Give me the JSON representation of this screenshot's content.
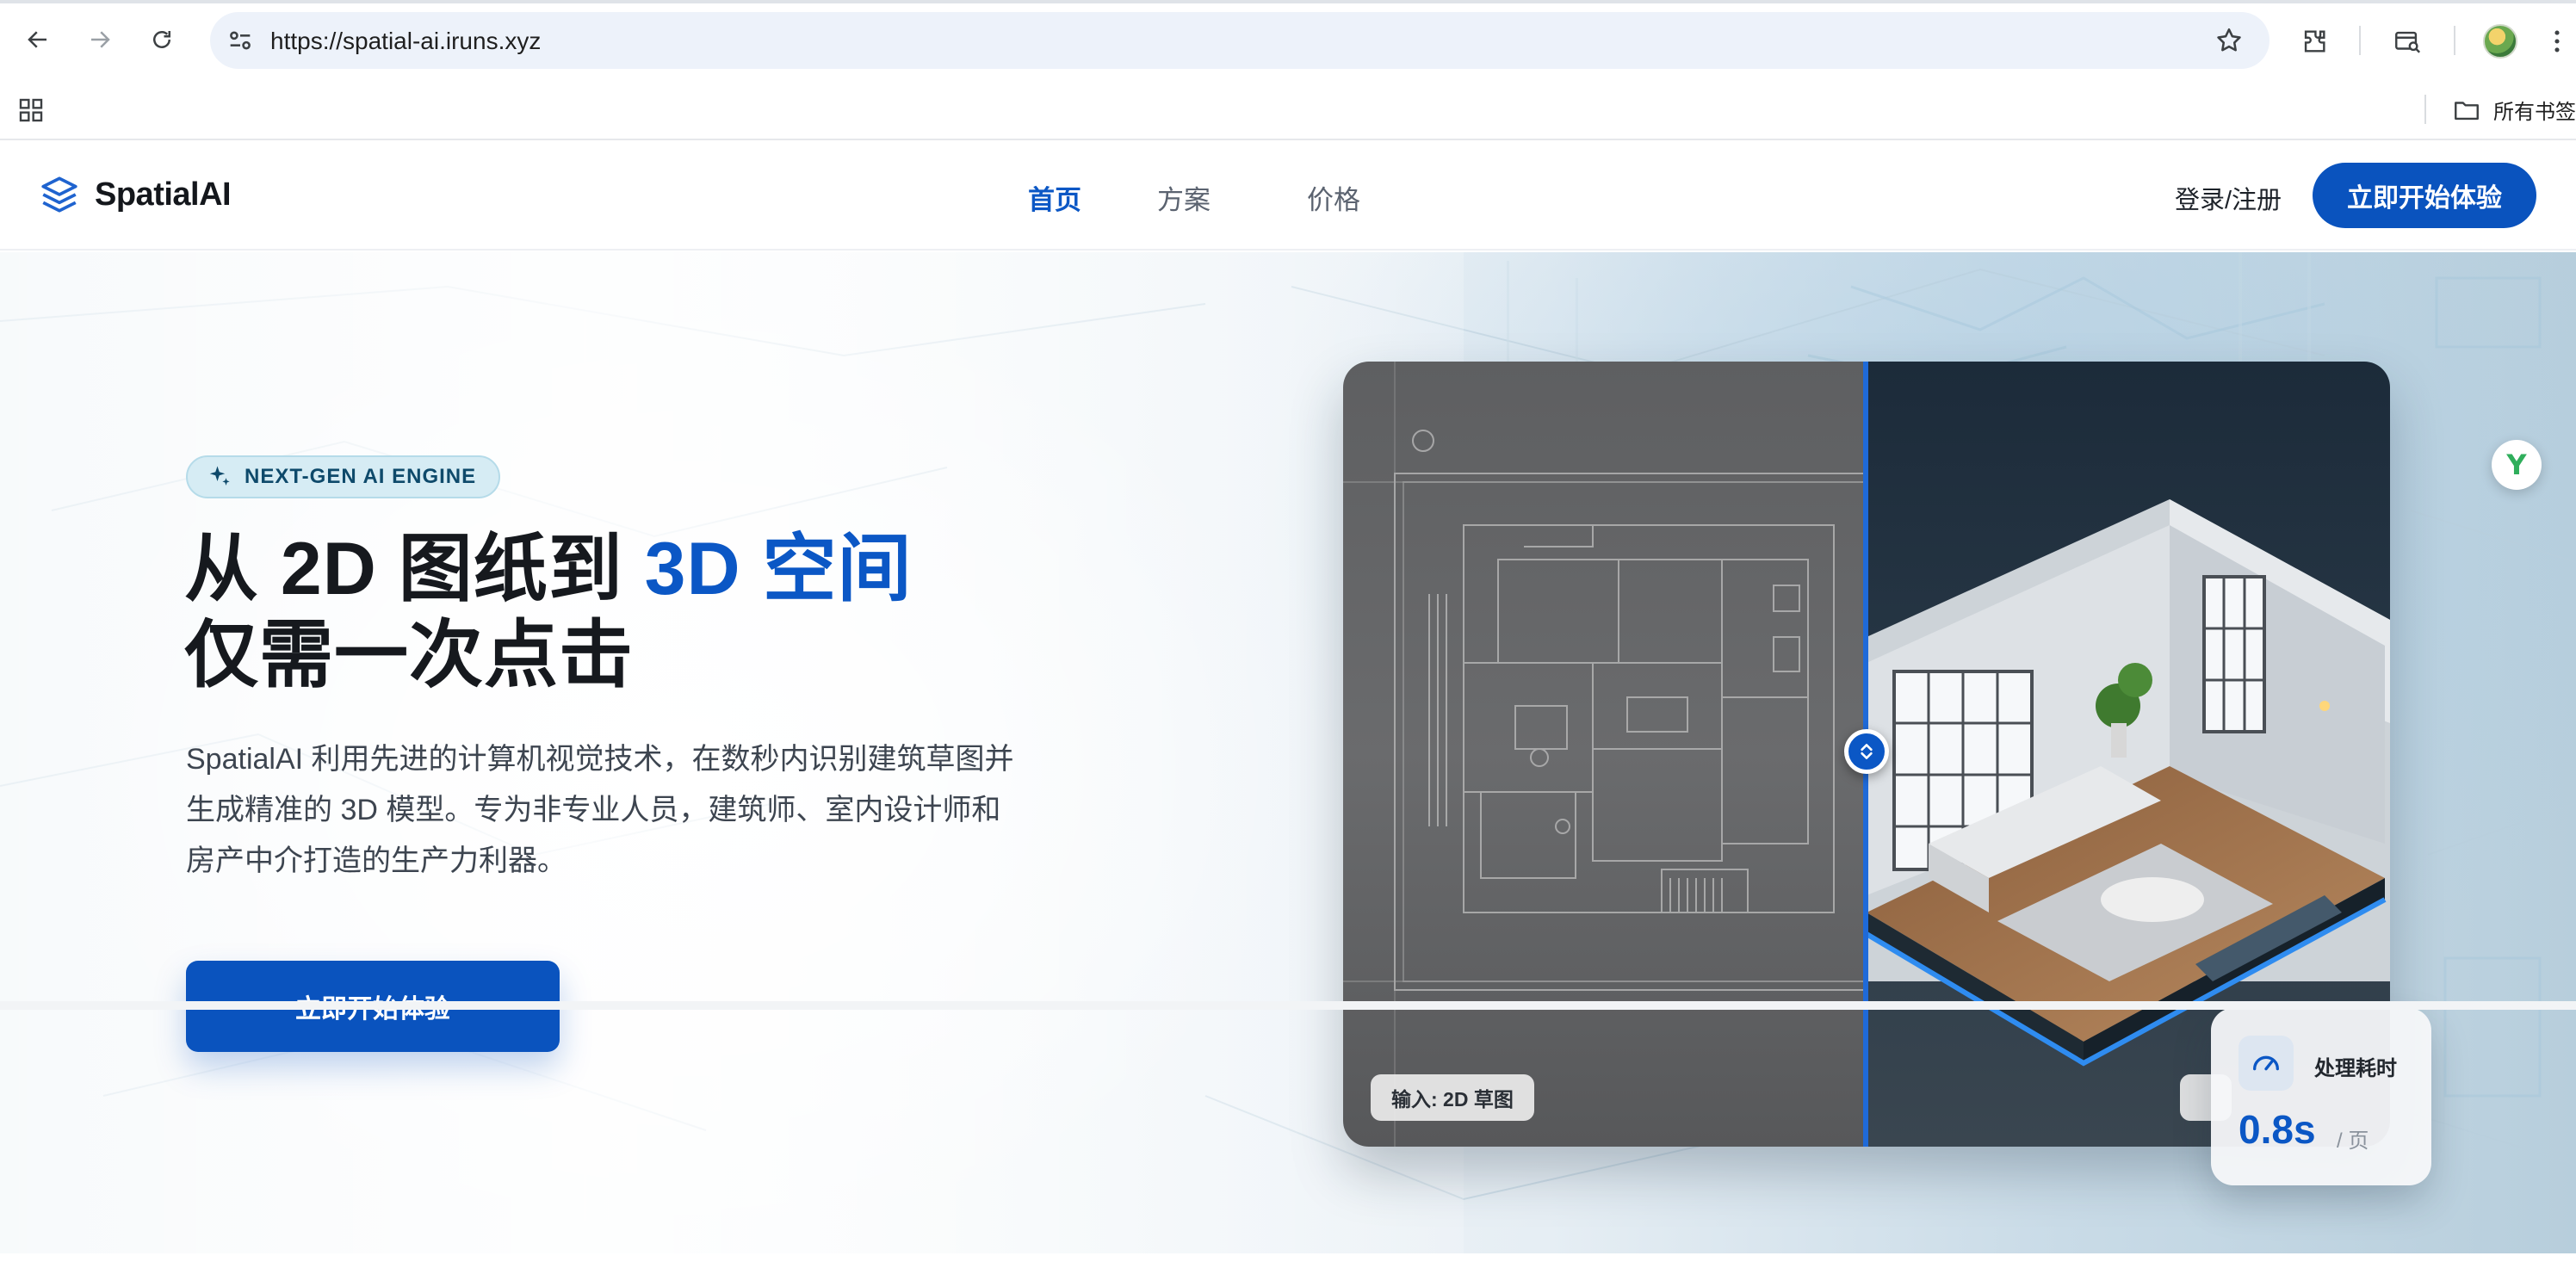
{
  "browser": {
    "url": "https://spatial-ai.iruns.xyz",
    "bookmarks_folder": "所有书签"
  },
  "site": {
    "logo_text": "SpatialAI",
    "nav": [
      {
        "label": "首页",
        "active": true
      },
      {
        "label": "方案",
        "active": false
      },
      {
        "label": "价格",
        "active": false
      }
    ],
    "login_label": "登录/注册",
    "cta_label": "立即开始体验"
  },
  "hero": {
    "badge": "NEXT-GEN AI ENGINE",
    "headline_part1": "从 2D 图纸到 ",
    "headline_accent": "3D 空间",
    "headline_line2": "仅需一次点击",
    "description_lines": [
      "SpatialAI 利用先进的计算机视觉技术，在数秒内识别建筑草图并",
      "生成精准的 3D 模型。专为非专业人员，建筑师、室内设计师和",
      "房产中介打造的生产力利器。"
    ],
    "cta_label": "立即开始体验"
  },
  "compare": {
    "input_tag": "输入: 2D 草图"
  },
  "stat": {
    "title": "处理耗时",
    "value": "0.8s",
    "unit": "/ 页"
  },
  "float_button_glyph": "Y",
  "colors": {
    "brand": "#0a53be",
    "accent_text": "#0b57c5",
    "badge_bg": "#d6ecf4"
  }
}
